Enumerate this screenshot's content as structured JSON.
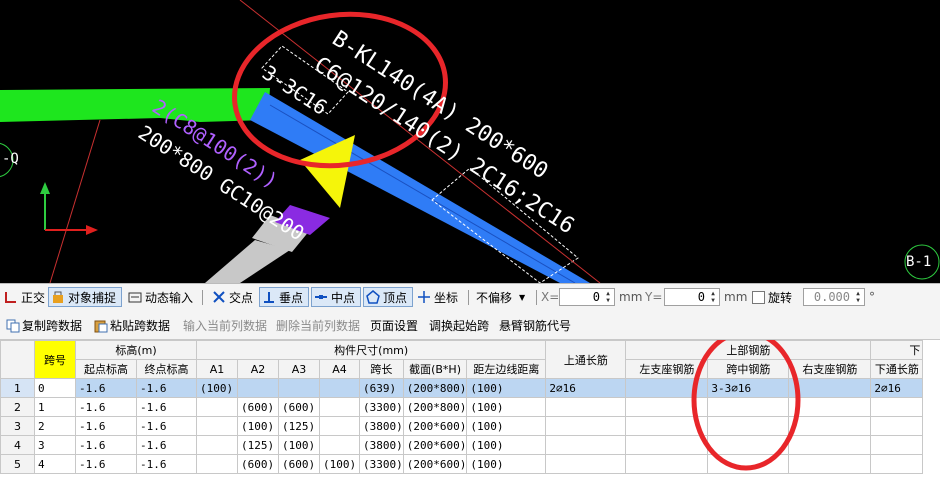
{
  "cad": {
    "beam_label": [
      "B-KL140(4A) 200*600",
      "C6@120/140(2) 2C16;2C16"
    ],
    "left_label": [
      "200*800 GC10@200"
    ],
    "purple_label": "2(C8@100(2))",
    "box_label": "3-3C16",
    "axis_left": "-Q",
    "axis_right": "B-1"
  },
  "snapbar": {
    "ortho": "正交",
    "snap": "对象捕捉",
    "dynamic": "动态输入",
    "intersection": "交点",
    "perpendicular": "垂点",
    "midpoint": "中点",
    "vertex": "顶点",
    "coordinate": "坐标",
    "offset_select": "不偏移",
    "x_label": "X=",
    "x_value": "0",
    "x_unit": "mm",
    "y_label": "Y=",
    "y_value": "0",
    "y_unit": "mm",
    "rotate": "旋转",
    "rotate_value": "0.000",
    "degree": "°"
  },
  "toolbar2": {
    "copy_span": "复制跨数据",
    "paste_span": "粘贴跨数据",
    "input_col": "输入当前列数据",
    "delete_col": "删除当前列数据",
    "page_setup": "页面设置",
    "adjust_start": "调换起始跨",
    "cantilever": "悬臂钢筋代号"
  },
  "table": {
    "h_span": "跨号",
    "h_elev": "标高(m)",
    "h_start_elev": "起点标高",
    "h_end_elev": "终点标高",
    "h_dims": "构件尺寸(mm)",
    "h_a1": "A1",
    "h_a2": "A2",
    "h_a3": "A3",
    "h_a4": "A4",
    "h_span_len": "跨长",
    "h_section": "截面(B*H)",
    "h_dist": "距左边线距离",
    "h_top_through": "上通长筋",
    "h_top_rebar": "上部钢筋",
    "h_left_support": "左支座钢筋",
    "h_mid_span": "跨中钢筋",
    "h_right_support": "右支座钢筋",
    "h_bottom": "下",
    "h_bottom_through": "下通长筋",
    "rows": [
      {
        "n": "1",
        "span": "0",
        "se": "-1.6",
        "ee": "-1.6",
        "a1": "(100)",
        "a2": "",
        "a3": "",
        "a4": "",
        "len": "(639)",
        "sec": "(200*800)",
        "dist": "(100)",
        "top": "2⌀16",
        "left": "",
        "mid": "3-3⌀16",
        "right": "",
        "bot": "2⌀16"
      },
      {
        "n": "2",
        "span": "1",
        "se": "-1.6",
        "ee": "-1.6",
        "a1": "",
        "a2": "(600)",
        "a3": "(600)",
        "a4": "",
        "len": "(3300)",
        "sec": "(200*800)",
        "dist": "(100)",
        "top": "",
        "left": "",
        "mid": "",
        "right": "",
        "bot": ""
      },
      {
        "n": "3",
        "span": "2",
        "se": "-1.6",
        "ee": "-1.6",
        "a1": "",
        "a2": "(100)",
        "a3": "(125)",
        "a4": "",
        "len": "(3800)",
        "sec": "(200*600)",
        "dist": "(100)",
        "top": "",
        "left": "",
        "mid": "",
        "right": "",
        "bot": ""
      },
      {
        "n": "4",
        "span": "3",
        "se": "-1.6",
        "ee": "-1.6",
        "a1": "",
        "a2": "(125)",
        "a3": "(100)",
        "a4": "",
        "len": "(3800)",
        "sec": "(200*600)",
        "dist": "(100)",
        "top": "",
        "left": "",
        "mid": "",
        "right": "",
        "bot": ""
      },
      {
        "n": "5",
        "span": "4",
        "se": "-1.6",
        "ee": "-1.6",
        "a1": "",
        "a2": "(600)",
        "a3": "(600)",
        "a4": "(100)",
        "len": "(3300)",
        "sec": "(200*600)",
        "dist": "(100)",
        "top": "",
        "left": "",
        "mid": "",
        "right": "",
        "bot": ""
      }
    ]
  },
  "colors": {
    "annotation_circle": "#e8262a",
    "beam_blue": "#2f7cf6",
    "beam_green": "#1ee61e",
    "arrow_yellow": "#f5f50a",
    "purple": "#8a2be2",
    "grey": "#c8c8c8"
  }
}
